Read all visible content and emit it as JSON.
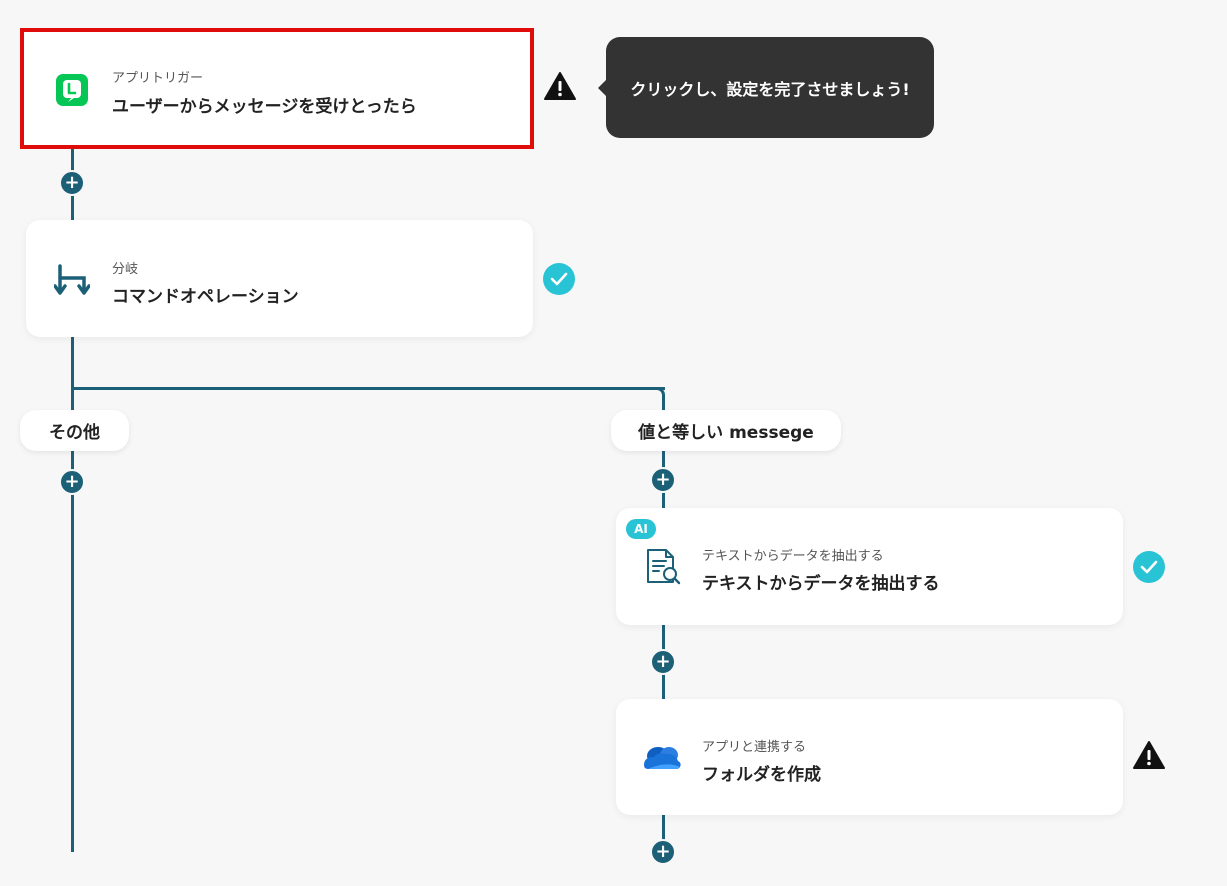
{
  "trigger": {
    "sub": "アプリトリガー",
    "title": "ユーザーからメッセージを受けとったら"
  },
  "tooltip": {
    "text": "クリックし、設定を完了させましょう!"
  },
  "branch": {
    "sub": "分岐",
    "title": "コマンドオペレーション"
  },
  "branches": {
    "left_label": "その他",
    "right_label": "値と等しい messege"
  },
  "extract": {
    "badge": "AI",
    "sub": "テキストからデータを抽出する",
    "title": "テキストからデータを抽出する"
  },
  "folder": {
    "sub": "アプリと連携する",
    "title": "フォルダを作成"
  },
  "add_symbol": "+",
  "colors": {
    "line": "#1c6078",
    "highlight": "#e00b0b",
    "check": "#29c3d6",
    "line_app": "#06c755",
    "onedrive": "#1a73d9"
  }
}
